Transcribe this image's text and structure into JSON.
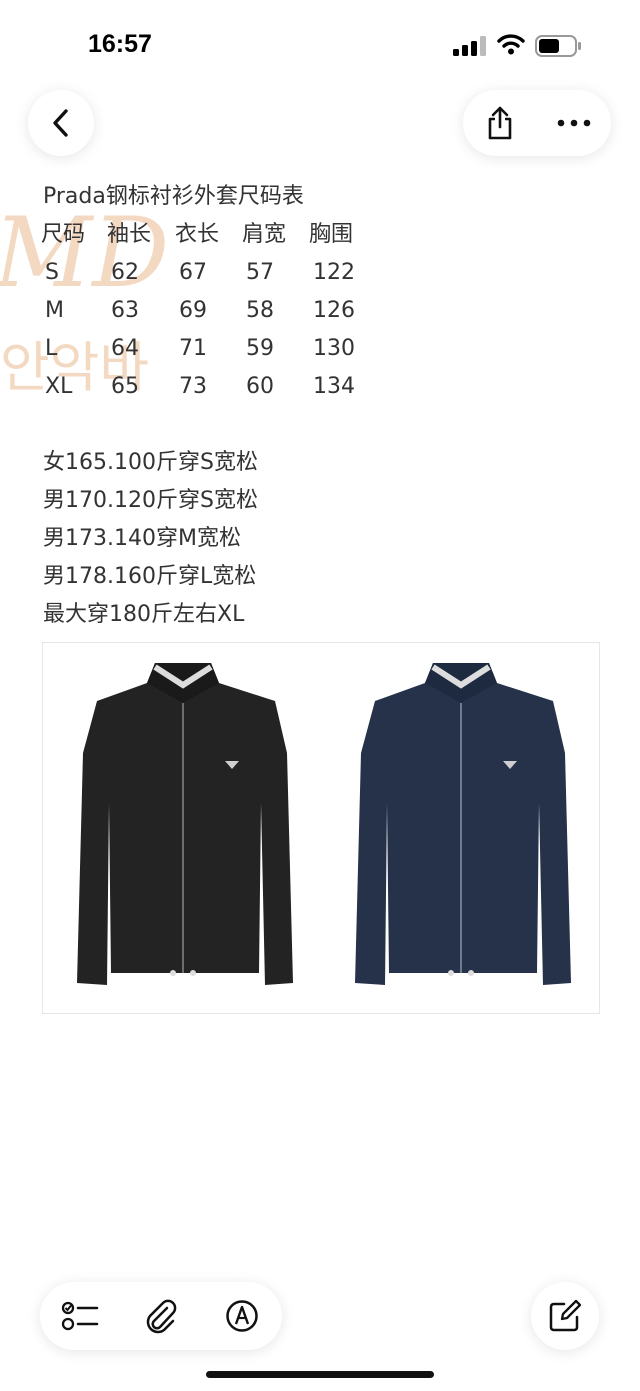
{
  "status_bar": {
    "time": "16:57",
    "battery_level": 0.6,
    "icons": [
      "signal-icon",
      "wifi-icon",
      "battery-icon"
    ]
  },
  "toolbar": {
    "back_icon": "chevron-left-icon",
    "share_icon": "share-icon",
    "more_icon": "more-icon"
  },
  "note": {
    "title": "Prada钢标衬衫外套尺码表",
    "table": {
      "headers": [
        "尺码",
        "袖长",
        "衣长",
        "肩宽",
        "胸围"
      ],
      "rows": [
        [
          "S",
          "62",
          "67",
          "57",
          "122"
        ],
        [
          "M",
          "63",
          "69",
          "58",
          "126"
        ],
        [
          "L",
          "64",
          "71",
          "59",
          "130"
        ],
        [
          "XL",
          "65",
          "73",
          "60",
          "134"
        ]
      ]
    },
    "recommendations": [
      "女165.100斤穿S宽松",
      "男170.120斤穿S宽松",
      "男173.140穿M宽松",
      "男178.160斤穿L宽松",
      "最大穿180斤左右XL"
    ]
  },
  "watermark": {
    "line1": "MD",
    "line2": "안악바"
  },
  "photo": {
    "items": [
      "black jacket",
      "navy jacket"
    ],
    "colors": {
      "black": "#232323",
      "navy": "#26324a"
    }
  },
  "bottom_toolbar": {
    "icons": [
      "checklist-icon",
      "paperclip-icon",
      "markup-icon"
    ],
    "compose_icon": "compose-icon"
  },
  "colors": {
    "text": "#333333",
    "background": "#ffffff",
    "watermark": "#f0c7a4"
  }
}
